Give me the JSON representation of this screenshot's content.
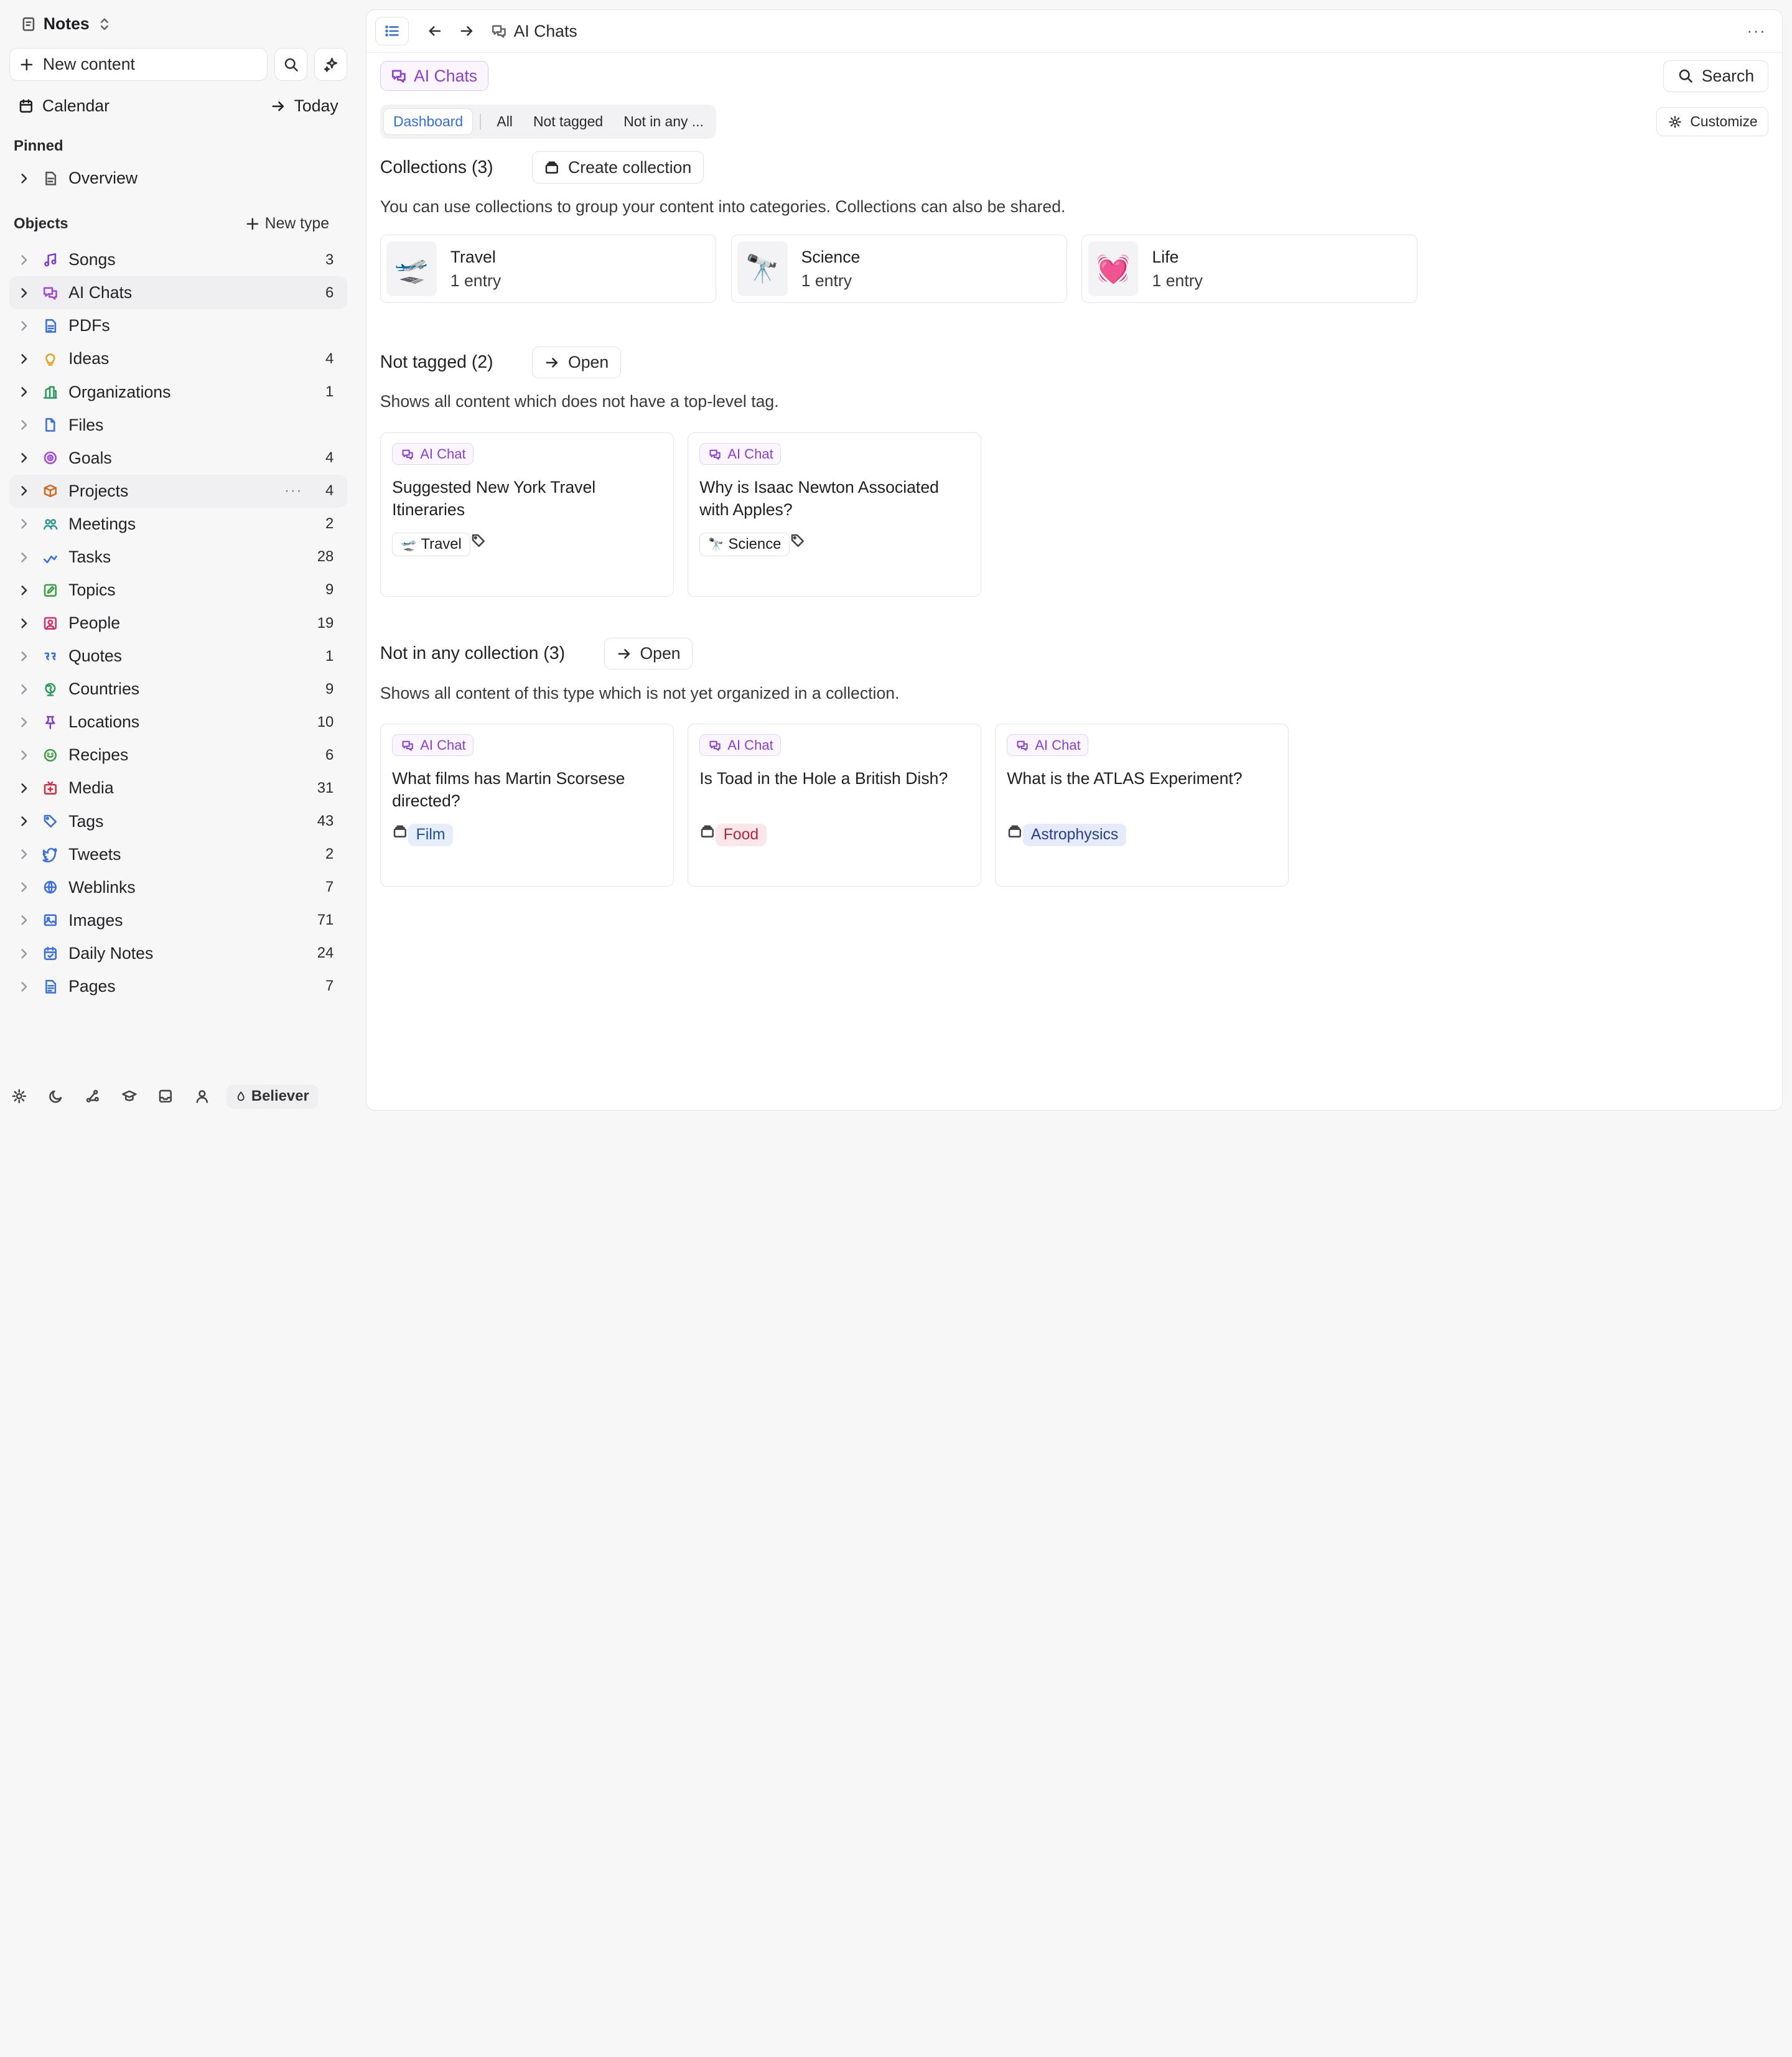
{
  "workspace": {
    "name": "Notes"
  },
  "sidebar": {
    "new_content": "New content",
    "calendar": "Calendar",
    "today": "Today",
    "pinned_label": "Pinned",
    "pinned": [
      {
        "label": "Overview"
      }
    ],
    "objects_label": "Objects",
    "new_type": "New type",
    "items": [
      {
        "label": "Songs",
        "count": "3",
        "icon": "music-icon",
        "color": "#7a3fd0"
      },
      {
        "label": "AI Chats",
        "count": "6",
        "icon": "chat-icon",
        "color": "#a049d8"
      },
      {
        "label": "PDFs",
        "count": "",
        "icon": "pdf-icon",
        "color": "#3a6fe0"
      },
      {
        "label": "Ideas",
        "count": "4",
        "icon": "bulb-icon",
        "color": "#e0a020"
      },
      {
        "label": "Organizations",
        "count": "1",
        "icon": "building-icon",
        "color": "#2a9a5a"
      },
      {
        "label": "Files",
        "count": "",
        "icon": "file-icon",
        "color": "#3a6fe0"
      },
      {
        "label": "Goals",
        "count": "4",
        "icon": "target-icon",
        "color": "#a049d8"
      },
      {
        "label": "Projects",
        "count": "4",
        "icon": "box-icon",
        "color": "#d06a20"
      },
      {
        "label": "Meetings",
        "count": "2",
        "icon": "people-icon",
        "color": "#2a9a8a"
      },
      {
        "label": "Tasks",
        "count": "28",
        "icon": "check-icon",
        "color": "#3a6fe0"
      },
      {
        "label": "Topics",
        "count": "9",
        "icon": "edit-icon",
        "color": "#3aa040"
      },
      {
        "label": "People",
        "count": "19",
        "icon": "person-icon",
        "color": "#d0306a"
      },
      {
        "label": "Quotes",
        "count": "1",
        "icon": "quote-icon",
        "color": "#3a6fe0"
      },
      {
        "label": "Countries",
        "count": "9",
        "icon": "globe-icon",
        "color": "#2a9a5a"
      },
      {
        "label": "Locations",
        "count": "10",
        "icon": "pin-icon",
        "color": "#7a3fd0"
      },
      {
        "label": "Recipes",
        "count": "6",
        "icon": "recipe-icon",
        "color": "#3aa040"
      },
      {
        "label": "Media",
        "count": "31",
        "icon": "tv-icon",
        "color": "#d03040"
      },
      {
        "label": "Tags",
        "count": "43",
        "icon": "tag-icon",
        "color": "#3a6fe0"
      },
      {
        "label": "Tweets",
        "count": "2",
        "icon": "bird-icon",
        "color": "#3a6fe0"
      },
      {
        "label": "Weblinks",
        "count": "7",
        "icon": "web-icon",
        "color": "#3a6fe0"
      },
      {
        "label": "Images",
        "count": "71",
        "icon": "image-icon",
        "color": "#3a6fe0"
      },
      {
        "label": "Daily Notes",
        "count": "24",
        "icon": "calendar-check-icon",
        "color": "#3a6fe0"
      },
      {
        "label": "Pages",
        "count": "7",
        "icon": "page-icon",
        "color": "#3a6fe0"
      }
    ],
    "footer": {
      "plan": "Believer"
    }
  },
  "main": {
    "breadcrumb": "AI Chats",
    "type_pill": "AI Chats",
    "search": "Search",
    "tabs": [
      "Dashboard",
      "All",
      "Not tagged",
      "Not in any ..."
    ],
    "customize": "Customize",
    "collections": {
      "title": "Collections (3)",
      "button": "Create collection",
      "desc": "You can use collections to group your content into categories. Collections can also be shared.",
      "items": [
        {
          "emoji": "🛫",
          "name": "Travel",
          "sub": "1 entry"
        },
        {
          "emoji": "🔭",
          "name": "Science",
          "sub": "1 entry"
        },
        {
          "emoji": "💓",
          "name": "Life",
          "sub": "1 entry"
        }
      ]
    },
    "not_tagged": {
      "title": "Not tagged (2)",
      "button": "Open",
      "desc": "Shows all content which does not have a top-level tag.",
      "cards": [
        {
          "chip": "AI Chat",
          "title": "Suggested New York Travel Itineraries",
          "tag_emoji": "🛫",
          "tag": "Travel"
        },
        {
          "chip": "AI Chat",
          "title": "Why is Isaac Newton Associated with Apples?",
          "tag_emoji": "🔭",
          "tag": "Science"
        }
      ]
    },
    "not_in_collection": {
      "title": "Not in any collection (3)",
      "button": "Open",
      "desc": "Shows all content of this type which is not yet organized in a collection.",
      "cards": [
        {
          "chip": "AI Chat",
          "title": "What films has Martin Scorsese directed?",
          "label": "Film"
        },
        {
          "chip": "AI Chat",
          "title": "Is Toad in the Hole a British Dish?",
          "label": "Food"
        },
        {
          "chip": "AI Chat",
          "title": "What is the ATLAS Experiment?",
          "label": "Astrophysics"
        }
      ]
    }
  }
}
